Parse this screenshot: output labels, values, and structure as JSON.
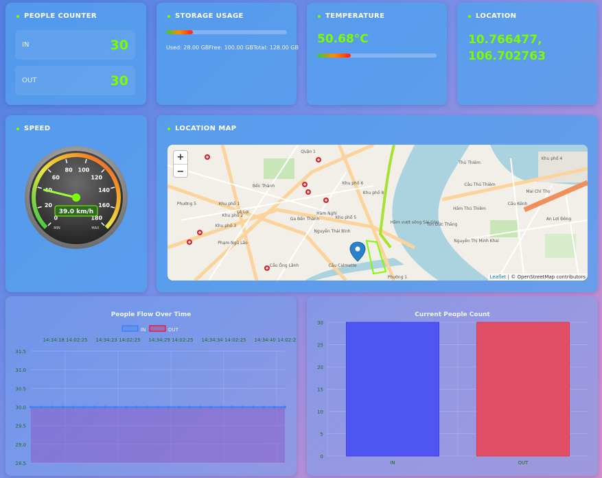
{
  "people_counter": {
    "title": "PEOPLE COUNTER",
    "in_label": "IN",
    "in_value": "30",
    "out_label": "OUT",
    "out_value": "30"
  },
  "storage": {
    "title": "STORAGE USAGE",
    "used_fraction": 0.22,
    "text": "Used: 28.00 GBFree: 100.00 GBTotal: 128.00 GB"
  },
  "temperature": {
    "title": "TEMPERATURE",
    "value": "50.68°C",
    "fraction": 0.28
  },
  "location": {
    "title": "LOCATION",
    "lat": "10.766477,",
    "lng": "106.702763"
  },
  "speed": {
    "title": "SPEED",
    "value": 39.0,
    "readout": "39.0 km/h",
    "min_label": "MIN",
    "max_label": "MAX",
    "ticks": [
      "0",
      "20",
      "40",
      "60",
      "80",
      "100",
      "120",
      "140",
      "160",
      "180"
    ]
  },
  "map": {
    "title": "LOCATION MAP",
    "zoom_in": "+",
    "zoom_out": "−",
    "attribution_link": "Leaflet",
    "attribution_rest": " | © OpenStreetMap contributors",
    "places": [
      "Quận 1",
      "Bến Thành",
      "Khu phố 1",
      "Khu phố 2",
      "Khu phố 3",
      "Khu phố 4",
      "Khu phố 5",
      "Khu phố 6",
      "Khu phố 8",
      "Phường 5",
      "Phạm Ngũ Lão",
      "Cầu Ông Lãnh",
      "Cầu Calmette",
      "Nguyễn Thái Bình",
      "Hàm Nghi",
      "Ga Bến Thành",
      "Thủ Thiêm",
      "Cầu Kênh",
      "Mai Chí Thọ",
      "An Lợi Đông",
      "Phường 1",
      "Hầm Thủ Thiêm",
      "Tôn Đức Thắng",
      "Nguyễn Thị Minh Khai",
      "Hầm vượt sông Sài Gòn",
      "Cầu Thủ Thiêm",
      "Lê Lợi"
    ]
  },
  "flow_chart": {
    "title": "People Flow Over Time",
    "legend": [
      {
        "name": "IN",
        "color": "#3b82f6"
      },
      {
        "name": "OUT",
        "color": "#e11d48"
      }
    ],
    "x_labels": [
      "14:34:18 14:02:25",
      "14:34:23 14:02:25",
      "14:34:29 14:02:25",
      "14:34:34 14:02:25",
      "14:34:40 14:02:25"
    ],
    "y_ticks": [
      "31.5",
      "31.0",
      "30.5",
      "30.0",
      "29.5",
      "29.0",
      "28.5"
    ]
  },
  "count_chart": {
    "title": "Current People Count",
    "y_ticks": [
      "30",
      "25",
      "20",
      "15",
      "10",
      "5",
      "0"
    ]
  },
  "chart_data": [
    {
      "type": "line",
      "title": "People Flow Over Time",
      "x": [
        "14:34:18 14:02:25",
        "14:34:23 14:02:25",
        "14:34:29 14:02:25",
        "14:34:34 14:02:25",
        "14:34:40 14:02:25"
      ],
      "series": [
        {
          "name": "IN",
          "values": [
            30,
            30,
            30,
            30,
            30,
            30,
            30,
            30,
            30,
            30,
            30,
            30,
            30,
            30,
            30,
            30,
            30,
            30,
            30,
            30,
            30,
            30,
            30,
            30,
            30
          ]
        },
        {
          "name": "OUT",
          "values": [
            30,
            30,
            30,
            30,
            30,
            30,
            30,
            30,
            30,
            30,
            30,
            30,
            30,
            30,
            30,
            30,
            30,
            30,
            30,
            30,
            30,
            30,
            30,
            30,
            30
          ]
        }
      ],
      "ylim": [
        28.5,
        31.5
      ],
      "grid": true,
      "legend": "top"
    },
    {
      "type": "bar",
      "title": "Current People Count",
      "categories": [
        "IN",
        "OUT"
      ],
      "values": [
        30,
        30
      ],
      "colors": [
        "#4f55f0",
        "#e04f66"
      ],
      "ylim": [
        0,
        30
      ],
      "grid": true
    }
  ]
}
